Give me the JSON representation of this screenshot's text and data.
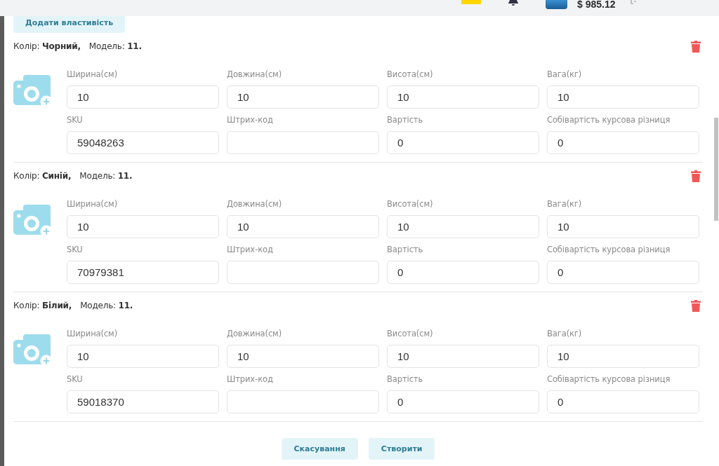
{
  "topbar": {
    "balance": "$ 985.12"
  },
  "add_property_button": {
    "label": "Додати властивість"
  },
  "variants": [
    {
      "color_text": "Колір: **Чорний,**",
      "model_text": "Модель: **11.**",
      "fields": [
        {
          "label": "Ширина(см)",
          "value": "10"
        },
        {
          "label": "Довжина(см)",
          "value": "10"
        },
        {
          "label": "Висота(см)",
          "value": "10"
        },
        {
          "label": "Вага(кг)",
          "value": "10"
        },
        {
          "label": "SKU",
          "value": "59048263"
        },
        {
          "label": "Штрих-код"
        },
        {
          "label": "Вартість",
          "value": "0"
        },
        {
          "label": "Собівартість курсова різниця",
          "value": "0"
        }
      ]
    },
    {
      "color_text": "Колір: **Синій,**",
      "model_text": "Модель: **11.**",
      "fields": [
        {
          "label": "Ширина(см)",
          "value": "10"
        },
        {
          "label": "Довжина(см)",
          "value": "10"
        },
        {
          "label": "Висота(см)",
          "value": "10"
        },
        {
          "label": "Вага(кг)",
          "value": "10"
        },
        {
          "label": "SKU",
          "value": "70979381"
        },
        {
          "label": "Штрих-код"
        },
        {
          "label": "Вартість",
          "value": "0"
        },
        {
          "label": "Собівартість курсова різниця",
          "value": "0"
        }
      ]
    },
    {
      "color_text": "Колір: **Білий,**",
      "model_text": "Модель: **11.**",
      "fields": [
        {
          "label": "Ширина(см)",
          "value": "10"
        },
        {
          "label": "Довжина(см)",
          "value": "10"
        },
        {
          "label": "Висота(см)",
          "value": "10"
        },
        {
          "label": "Вага(кг)",
          "value": "10"
        },
        {
          "label": "SKU",
          "value": "59018370"
        },
        {
          "label": "Штрих-код"
        },
        {
          "label": "Вартість",
          "value": "0"
        },
        {
          "label": "Собівартість курсова різниця",
          "value": "0"
        }
      ]
    }
  ],
  "buttons": [
    {
      "label": "Скасування"
    },
    {
      "label": "Створити"
    }
  ]
}
